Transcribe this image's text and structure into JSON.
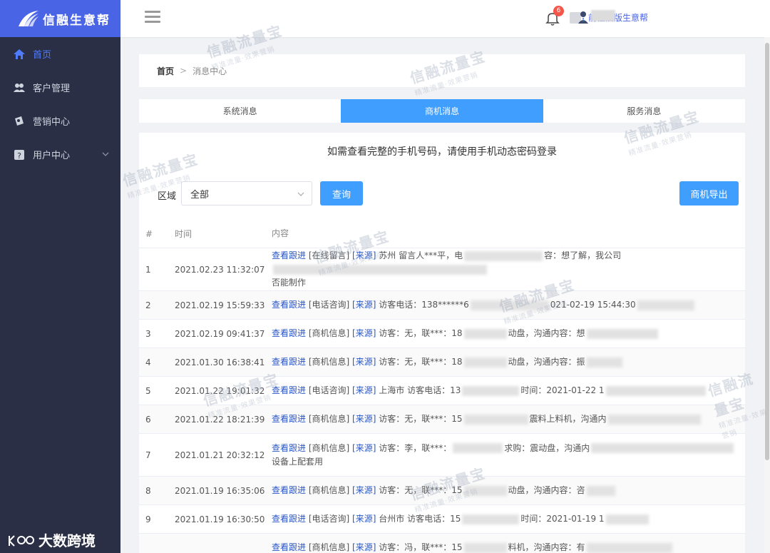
{
  "brand": {
    "name": "信融生意帮"
  },
  "sidebar": {
    "items": [
      {
        "label": "首页",
        "icon": "home-icon",
        "active": true
      },
      {
        "label": "客户管理",
        "icon": "users-icon"
      },
      {
        "label": "营销中心",
        "icon": "marketing-icon"
      },
      {
        "label": "用户中心",
        "icon": "user-center-icon",
        "expandable": true
      }
    ]
  },
  "header": {
    "old_version_link": "前往旧版生意帮",
    "notification_count": "6"
  },
  "breadcrumb": {
    "home": "首页",
    "separator": ">",
    "current": "消息中心"
  },
  "tabs": [
    {
      "label": "系统消息"
    },
    {
      "label": "商机消息",
      "active": true
    },
    {
      "label": "服务消息"
    }
  ],
  "notice": "如需查看完整的手机号码，请使用手机动态密码登录",
  "filter": {
    "label": "区域",
    "value": "全部",
    "query_button": "查询",
    "export_button": "商机导出"
  },
  "table": {
    "headers": [
      "#",
      "时间",
      "内容"
    ],
    "rows": [
      {
        "idx": "1",
        "time": "2021.02.23 11:32:07",
        "link": "查看跟进",
        "tag": "[在线留言]",
        "src": "[来源]",
        "text": "苏州 留言人***平，电",
        "tail": "容：想了解，我公司",
        "line2": "否能制作"
      },
      {
        "idx": "2",
        "time": "2021.02.19 15:59:33",
        "link": "查看跟进",
        "tag": "[电话咨询]",
        "src": "[来源]",
        "text": "访客电话：138******6",
        "tail": "021-02-19 15:44:30"
      },
      {
        "idx": "3",
        "time": "2021.02.19 09:41:37",
        "link": "查看跟进",
        "tag": "[商机信息]",
        "src": "[来源]",
        "text": "访客：无，联***：18",
        "tail": "动盘，沟通内容：想"
      },
      {
        "idx": "4",
        "time": "2021.01.30 16:38:41",
        "link": "查看跟进",
        "tag": "[商机信息]",
        "src": "[来源]",
        "text": "访客：无，联***：18",
        "tail": "动盘，沟通内容：振"
      },
      {
        "idx": "5",
        "time": "2021.01.22 19:01:32",
        "link": "查看跟进",
        "tag": "[电话咨询]",
        "src": "[来源]",
        "text": "上海市 访客电话：13",
        "tail": "时间：2021-01-22 1"
      },
      {
        "idx": "6",
        "time": "2021.01.22 18:21:39",
        "link": "查看跟进",
        "tag": "[商机信息]",
        "src": "[来源]",
        "text": "访客：无，联***：15",
        "tail": "震料上料机，沟通内"
      },
      {
        "idx": "7",
        "time": "2021.01.21 20:32:12",
        "link": "查看跟进",
        "tag": "[商机信息]",
        "src": "[来源]",
        "text": "访客：李，联***：",
        "tail": "求购：震动盘，沟通内",
        "line2": "设备上配套用"
      },
      {
        "idx": "8",
        "time": "2021.01.19 16:35:06",
        "link": "查看跟进",
        "tag": "[商机信息]",
        "src": "[来源]",
        "text": "访客：无，联***：15",
        "tail": "动盘，沟通内容：咨"
      },
      {
        "idx": "9",
        "time": "2021.01.19 16:30:50",
        "link": "查看跟进",
        "tag": "[电话咨询]",
        "src": "[来源]",
        "text": "台州市 访客电话：15",
        "tail": "时间：2021-01-19 1"
      },
      {
        "idx": "",
        "time": "",
        "link": "查看跟进",
        "tag": "[商机信息]",
        "src": "[来源]",
        "text": "访客：冯，联***：15",
        "tail": "料机，沟通内容：有"
      }
    ]
  },
  "watermark": {
    "main": "信融流量宝",
    "sub": "精准流量·效果营销"
  },
  "corner_brand": "大数跨境"
}
